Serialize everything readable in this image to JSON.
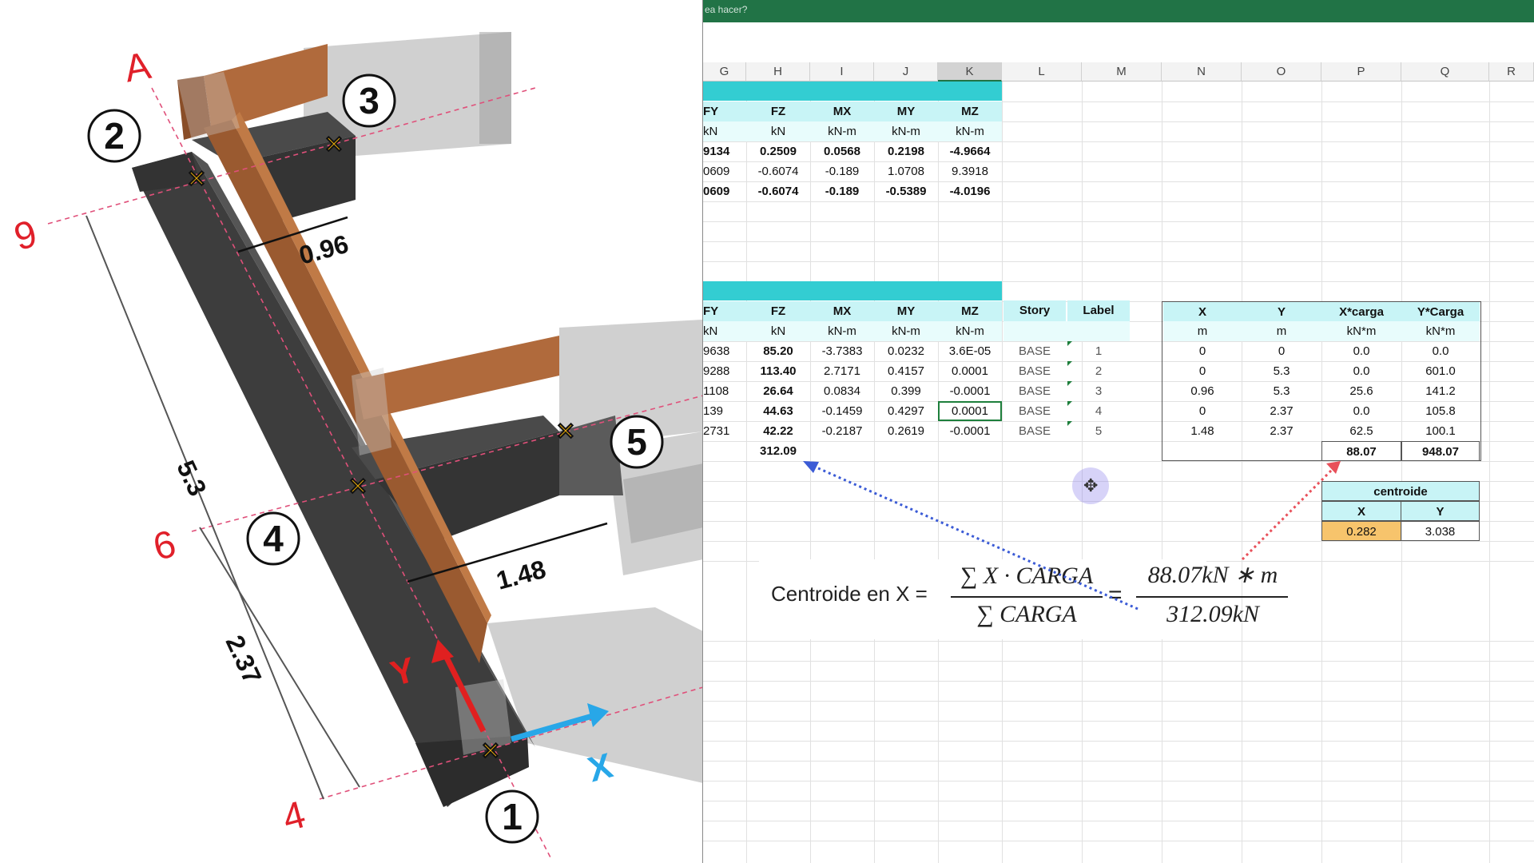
{
  "model": {
    "numbers": [
      "1",
      "2",
      "3",
      "4",
      "5"
    ],
    "axis_labels": [
      "A",
      "9",
      "6",
      "4"
    ],
    "dimensions": [
      "0.96",
      "1.48",
      "5.3",
      "2.37"
    ],
    "direction_labels": [
      "Y",
      "X"
    ]
  },
  "excel": {
    "ribbon_text": "ea hacer?",
    "columns": [
      "G",
      "H",
      "I",
      "J",
      "K",
      "L",
      "M",
      "N",
      "O",
      "P",
      "Q",
      "R"
    ],
    "table1": {
      "headers": [
        "FY",
        "FZ",
        "MX",
        "MY",
        "MZ"
      ],
      "units": [
        "kN",
        "kN",
        "kN-m",
        "kN-m",
        "kN-m"
      ],
      "rows": [
        [
          "9134",
          "0.2509",
          "0.0568",
          "0.2198",
          "-4.9664"
        ],
        [
          "0609",
          "-0.6074",
          "-0.189",
          "1.0708",
          "9.3918"
        ],
        [
          "0609",
          "-0.6074",
          "-0.189",
          "-0.5389",
          "-4.0196"
        ]
      ]
    },
    "table2": {
      "headers": [
        "FY",
        "FZ",
        "MX",
        "MY",
        "MZ",
        "Story",
        "Label"
      ],
      "units": [
        "kN",
        "kN",
        "kN-m",
        "kN-m",
        "kN-m"
      ],
      "rows": [
        [
          "9638",
          "85.20",
          "-3.7383",
          "0.0232",
          "3.6E-05",
          "BASE",
          "1"
        ],
        [
          "9288",
          "113.40",
          "2.7171",
          "0.4157",
          "0.0001",
          "BASE",
          "2"
        ],
        [
          "1108",
          "26.64",
          "0.0834",
          "0.399",
          "-0.0001",
          "BASE",
          "3"
        ],
        [
          "139",
          "44.63",
          "-0.1459",
          "0.4297",
          "0.0001",
          "BASE",
          "4"
        ],
        [
          "2731",
          "42.22",
          "-0.2187",
          "0.2619",
          "-0.0001",
          "BASE",
          "5"
        ]
      ],
      "total_fz": "312.09"
    },
    "table3": {
      "headers": [
        "X",
        "Y",
        "X*carga",
        "Y*Carga"
      ],
      "units": [
        "m",
        "m",
        "kN*m",
        "kN*m"
      ],
      "rows": [
        [
          "0",
          "0",
          "0.0",
          "0.0"
        ],
        [
          "0",
          "5.3",
          "0.0",
          "601.0"
        ],
        [
          "0.96",
          "5.3",
          "25.6",
          "141.2"
        ],
        [
          "0",
          "2.37",
          "0.0",
          "105.8"
        ],
        [
          "1.48",
          "2.37",
          "62.5",
          "100.1"
        ]
      ],
      "totals": [
        "88.07",
        "948.07"
      ]
    },
    "centroid": {
      "title": "centroide",
      "headers": [
        "X",
        "Y"
      ],
      "values": [
        "0.282",
        "3.038"
      ]
    },
    "formula": {
      "prefix": "Centroide en X =",
      "num1": "∑ X · CARGA",
      "den1": "∑ CARGA",
      "equals": "=",
      "num2": "88.07kN ∗ m",
      "den2": "312.09kN"
    },
    "cursor_icon": "✥"
  }
}
